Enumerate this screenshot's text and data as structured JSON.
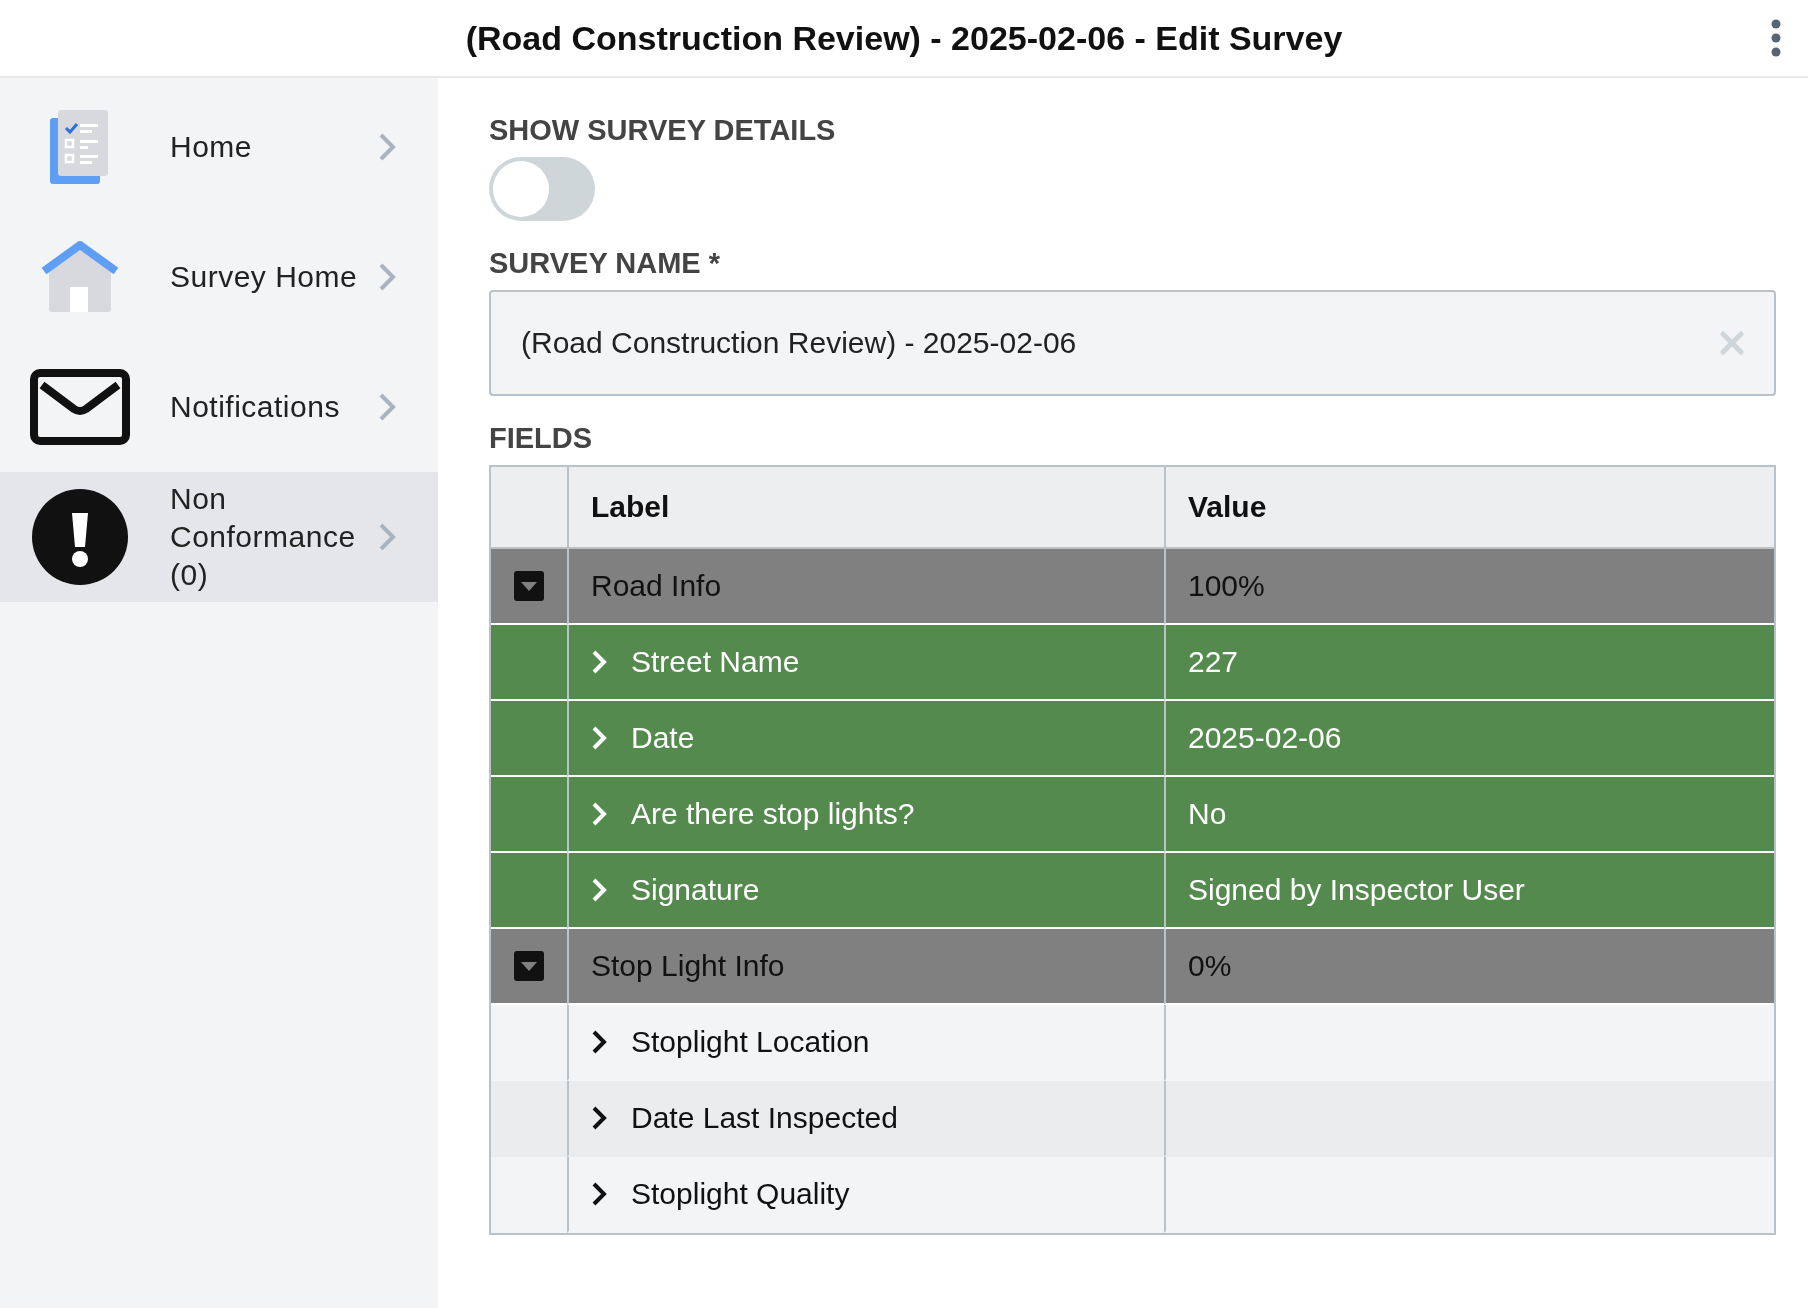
{
  "header": {
    "title": "(Road Construction Review) - 2025-02-06 - Edit Survey"
  },
  "sidebar": {
    "items": [
      {
        "label": "Home",
        "selected": false
      },
      {
        "label": "Survey Home",
        "selected": false
      },
      {
        "label": "Notifications",
        "selected": false
      },
      {
        "label": "Non Conformance (0)",
        "selected": true
      }
    ]
  },
  "survey_details": {
    "label": "SHOW SURVEY DETAILS",
    "on": false
  },
  "survey_name": {
    "label": "SURVEY NAME *",
    "value": "(Road Construction Review) - 2025-02-06"
  },
  "fields": {
    "label": "FIELDS",
    "columns": [
      "Label",
      "Value"
    ],
    "rows": [
      {
        "label": "Road Info",
        "value": "100%",
        "expanded": true,
        "children": [
          {
            "label": "Street Name",
            "value": "227",
            "answered": true
          },
          {
            "label": "Date",
            "value": "2025-02-06",
            "answered": true
          },
          {
            "label": "Are there stop lights?",
            "value": "No",
            "answered": true
          },
          {
            "label": "Signature",
            "value": "Signed by Inspector User",
            "answered": true
          }
        ]
      },
      {
        "label": "Stop Light Info",
        "value": "0%",
        "expanded": true,
        "children": [
          {
            "label": "Stoplight Location",
            "answered": false
          },
          {
            "label": "Date Last Inspected",
            "answered": false
          },
          {
            "label": "Stoplight Quality",
            "answered": false
          }
        ]
      }
    ]
  }
}
